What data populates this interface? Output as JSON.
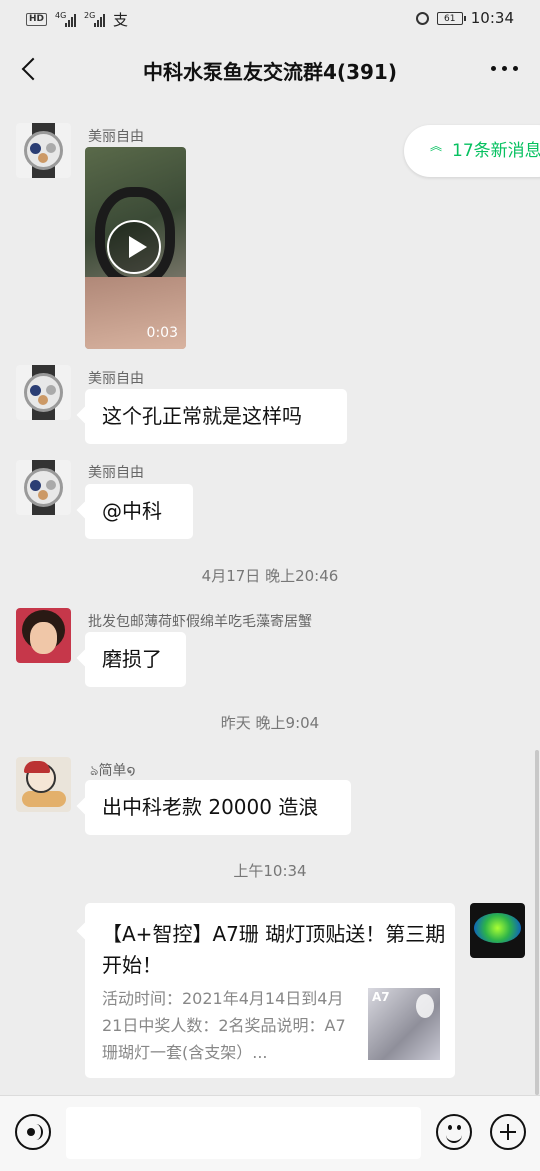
{
  "status": {
    "left_chips": [
      "HD",
      "4G",
      "2G",
      "支"
    ],
    "battery": "61",
    "time": "10:34"
  },
  "header": {
    "title": "中科水泵鱼友交流群4(391)"
  },
  "new_messages": "17条新消息",
  "messages": [
    {
      "sender": "美丽自由",
      "duration": "0:03"
    },
    {
      "sender": "美丽自由",
      "text": "这个孔正常就是这样吗"
    },
    {
      "sender": "美丽自由",
      "text": "@中科"
    },
    {
      "sender": "批发包邮薄荷虾假绵羊吃毛藻寄居蟹",
      "text": "磨损了"
    },
    {
      "sender": "简单",
      "text": "出中科老款 20000 造浪"
    }
  ],
  "timestamps": [
    "4月17日 晚上20:46",
    "昨天 晚上9:04",
    "上午10:34"
  ],
  "card": {
    "title": "【A+智控】A7珊 瑚灯顶贴送！第三期开始！",
    "description": "活动时间：2021年4月14日到4月21日中奖人数：2名奖品说明：A7珊瑚灯一套(含支架）...",
    "thumb_label": "A7"
  },
  "input": {
    "value": ""
  },
  "colors": {
    "accent": "#07c160",
    "background": "#ededed"
  }
}
